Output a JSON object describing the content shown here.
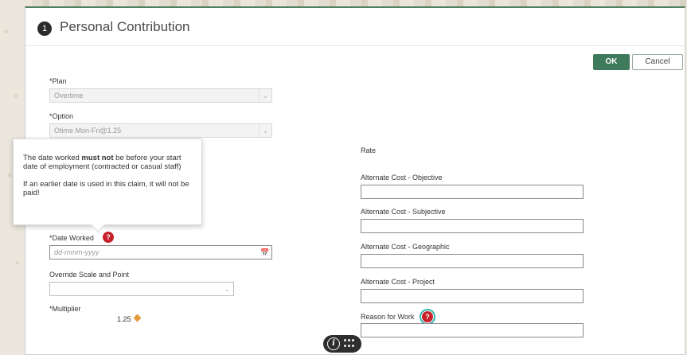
{
  "header": {
    "step": "1",
    "title": "Personal Contribution"
  },
  "actions": {
    "ok_label": "OK",
    "cancel_label": "Cancel"
  },
  "left": {
    "plan": {
      "label": "Plan",
      "value": "Overtime"
    },
    "option": {
      "label": "Option",
      "value": "Otime Mon-Fri@1.25"
    },
    "date_worked": {
      "label": "Date Worked",
      "placeholder": "dd-mmm-yyyy"
    },
    "override": {
      "label": "Override Scale and Point",
      "value": ""
    },
    "multiplier": {
      "label": "Multiplier",
      "value": "1.25"
    }
  },
  "tooltip": {
    "line1_pre": "The date worked ",
    "line1_bold": "must not",
    "line1_post": " be before your start date of employment (contracted or casual staff)",
    "line2": "If an earlier date is used in this claim, it will not be paid!"
  },
  "right": {
    "rate_label": "Rate",
    "fields": [
      {
        "label": "Alternate Cost - Objective",
        "value": ""
      },
      {
        "label": "Alternate Cost - Subjective",
        "value": ""
      },
      {
        "label": "Alternate Cost - Geographic",
        "value": ""
      },
      {
        "label": "Alternate Cost - Project",
        "value": ""
      }
    ],
    "reason": {
      "label": "Reason for Work",
      "value": ""
    }
  },
  "icons": {
    "help": "?",
    "info": "i",
    "calendar": "calendar-icon"
  },
  "colors": {
    "primary": "#3e7a5b",
    "help_red": "#c8202a",
    "focus_ring": "#35b6b0",
    "multiplier_diamond": "#e59a3b"
  }
}
